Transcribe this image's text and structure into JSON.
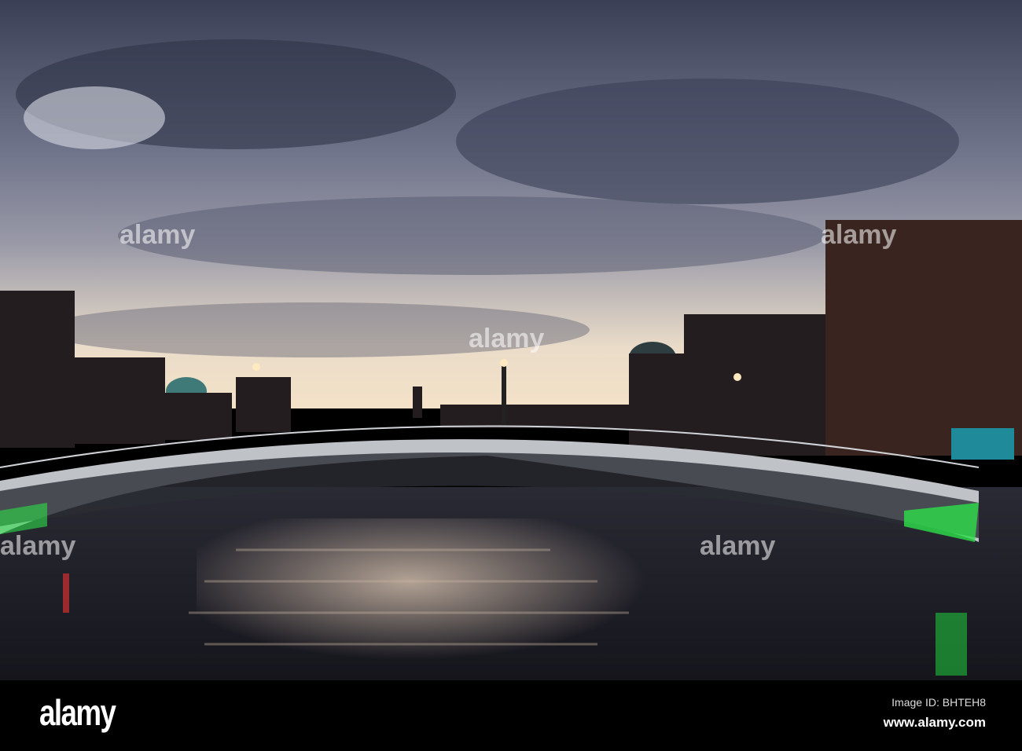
{
  "watermark": "alamy",
  "footer": {
    "logo": "alamy",
    "image_id": "Image ID: BHTEH8",
    "website": "www.alamy.com"
  },
  "colors": {
    "sky_dark": "#3d4257",
    "sky_light": "#e9dccb",
    "water": "#1d1d26",
    "bridge_light": "#2de04a"
  }
}
